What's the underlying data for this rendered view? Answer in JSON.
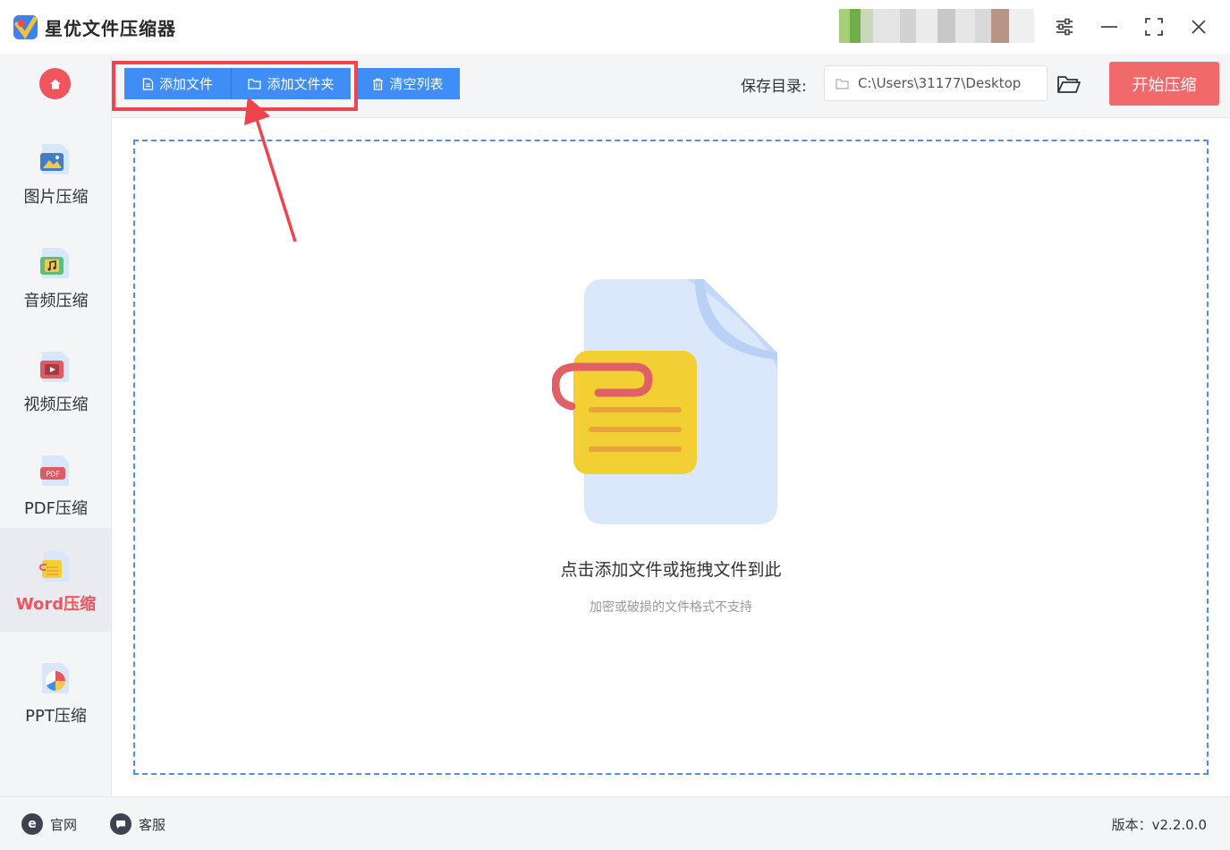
{
  "app": {
    "title": "星优文件压缩器"
  },
  "sidebar": {
    "items": [
      {
        "label": "图片压缩",
        "icon": "image-file-icon"
      },
      {
        "label": "音频压缩",
        "icon": "audio-file-icon"
      },
      {
        "label": "视频压缩",
        "icon": "video-file-icon"
      },
      {
        "label": "PDF压缩",
        "icon": "pdf-file-icon",
        "badge": "PDF"
      },
      {
        "label": "Word压缩",
        "icon": "word-file-icon",
        "active": true
      },
      {
        "label": "PPT压缩",
        "icon": "ppt-file-icon"
      }
    ]
  },
  "toolbar": {
    "add_file_label": "添加文件",
    "add_folder_label": "添加文件夹",
    "clear_list_label": "清空列表",
    "save_dir_label": "保存目录:",
    "save_path": "C:\\Users\\31177\\Desktop",
    "start_label": "开始压缩"
  },
  "dropzone": {
    "title": "点击添加文件或拖拽文件到此",
    "subtitle": "加密或破损的文件格式不支持"
  },
  "footer": {
    "website_label": "官网",
    "support_label": "客服",
    "version": "版本：v2.2.0.0"
  },
  "colors": {
    "accent_blue": "#3f8ef8",
    "accent_red": "#f0545c",
    "start_button": "#f06a6c"
  }
}
